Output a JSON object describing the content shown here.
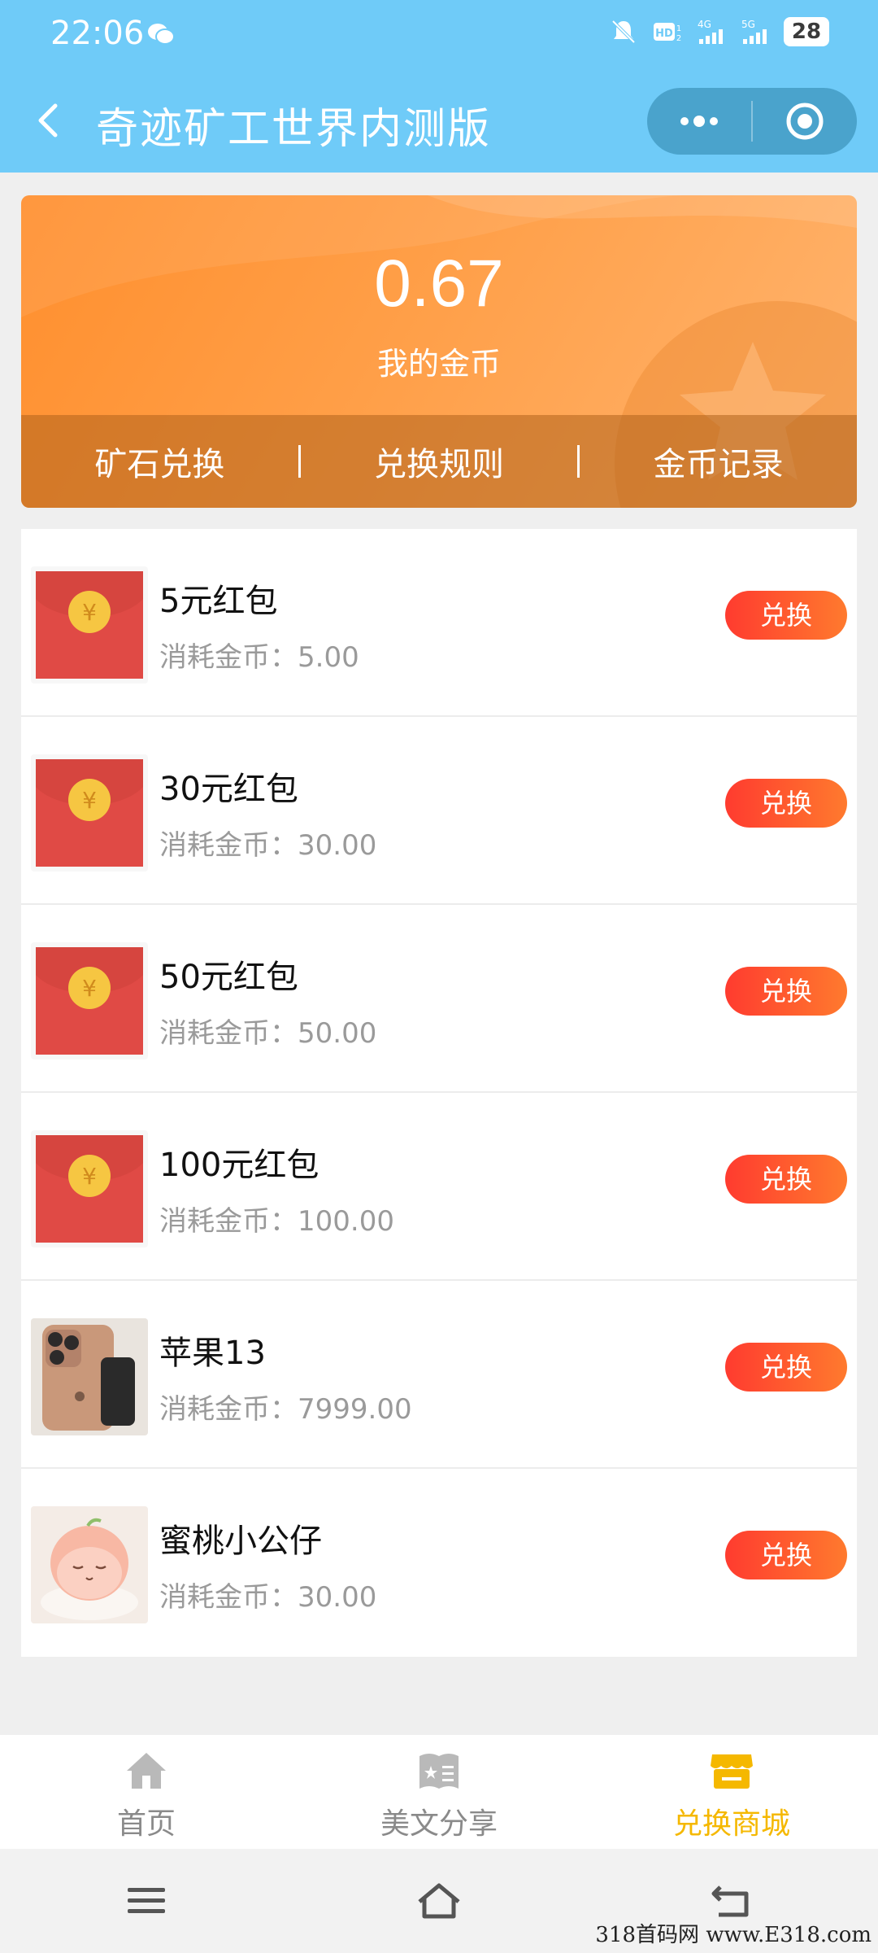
{
  "status_bar": {
    "time": "22:06",
    "battery": "28",
    "icons": [
      "wechat-icon",
      "mute-bell-icon",
      "hd-icon",
      "signal-4g-icon",
      "signal-5g-icon",
      "battery-icon"
    ]
  },
  "nav": {
    "title": "奇迹矿工世界内测版",
    "back_icon": "chevron-left-icon",
    "more_icon": "more-dots-icon",
    "close_icon": "target-circle-icon"
  },
  "coin_card": {
    "value": "0.67",
    "label": "我的金币",
    "actions": [
      "矿石兑换",
      "兑换规则",
      "金币记录"
    ],
    "colors": {
      "gradient_start": "#ff8f2e",
      "gradient_end": "#ffb46e"
    }
  },
  "products": {
    "cost_label": "消耗金币：",
    "redeem_label": "兑换",
    "items": [
      {
        "name": "5元红包",
        "cost": "5.00",
        "image": "red-envelope-icon"
      },
      {
        "name": "30元红包",
        "cost": "30.00",
        "image": "red-envelope-icon"
      },
      {
        "name": "50元红包",
        "cost": "50.00",
        "image": "red-envelope-icon"
      },
      {
        "name": "100元红包",
        "cost": "100.00",
        "image": "red-envelope-icon"
      },
      {
        "name": "苹果13",
        "cost": "7999.00",
        "image": "phone-image"
      },
      {
        "name": "蜜桃小公仔",
        "cost": "30.00",
        "image": "peach-doll-image"
      }
    ]
  },
  "tabs": [
    {
      "label": "首页",
      "icon": "home-icon",
      "active": false
    },
    {
      "label": "美文分享",
      "icon": "article-icon",
      "active": false
    },
    {
      "label": "兑换商城",
      "icon": "store-icon",
      "active": true
    }
  ],
  "colors": {
    "header": "#6fcbf8",
    "accent_active_tab": "#f5b800",
    "redeem_button_start": "#ff3b2f",
    "redeem_button_end": "#ff7a2e"
  },
  "watermark": "318首码网  www.E318.com"
}
